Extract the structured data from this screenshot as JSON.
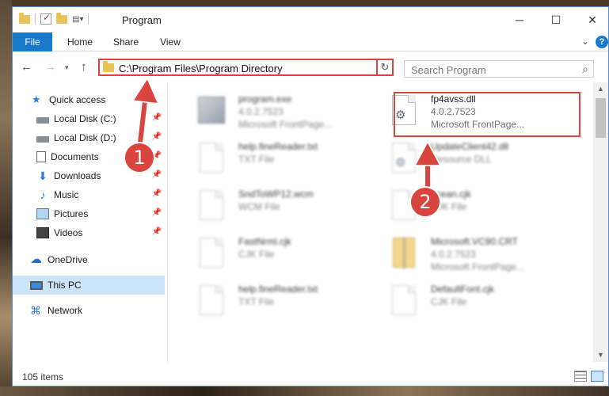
{
  "window": {
    "title": "Program",
    "minimize": "─",
    "maximize": "☐",
    "close": "✕"
  },
  "ribbon": {
    "tabs": [
      "File",
      "Home",
      "Share",
      "View"
    ],
    "expand": "⌄",
    "help": "?"
  },
  "nav": {
    "back": "←",
    "forward": "→",
    "history": "▾",
    "up": "↑",
    "address": "C:\\Program Files\\Program Directory",
    "address_dropdown": "⌄",
    "refresh": "↻",
    "search_placeholder": "Search Program",
    "search_icon": "⌕"
  },
  "sidebar": {
    "items": [
      {
        "label": "Quick access",
        "icon": "star-icon",
        "pinned": false
      },
      {
        "label": "Local Disk (C:)",
        "icon": "disk-icon",
        "pinned": true
      },
      {
        "label": "Local Disk (D:)",
        "icon": "disk-icon",
        "pinned": true
      },
      {
        "label": "Documents",
        "icon": "document-icon",
        "pinned": true
      },
      {
        "label": "Downloads",
        "icon": "download-icon",
        "pinned": true
      },
      {
        "label": "Music",
        "icon": "music-icon",
        "pinned": true
      },
      {
        "label": "Pictures",
        "icon": "pictures-icon",
        "pinned": true
      },
      {
        "label": "Videos",
        "icon": "videos-icon",
        "pinned": true
      },
      {
        "label": "OneDrive",
        "icon": "cloud-icon",
        "pinned": false
      },
      {
        "label": "This PC",
        "icon": "pc-icon",
        "pinned": false,
        "selected": true
      },
      {
        "label": "Network",
        "icon": "network-icon",
        "pinned": false
      }
    ],
    "pin_glyph": "📌"
  },
  "files": [
    {
      "name": "program.exe",
      "line1": "4.0.2.7523",
      "line2": "Microsoft FrontPage...",
      "icon": "exe"
    },
    {
      "name": "fp4avss.dll",
      "line1": "4.0.2.7523",
      "line2": "Microsoft FrontPage...",
      "icon": "dll"
    },
    {
      "name": "help.fineReader.txt",
      "line1": "TXT File",
      "line2": "",
      "icon": "page"
    },
    {
      "name": "UpdateClient42.dll",
      "line1": "Resource DLL",
      "line2": "",
      "icon": "dll"
    },
    {
      "name": "SndToWP12.wcm",
      "line1": "WCM File",
      "line2": "",
      "icon": "page"
    },
    {
      "name": "ocean.cjk",
      "line1": "CJK File",
      "line2": "",
      "icon": "page"
    },
    {
      "name": "FastNrml.cjk",
      "line1": "CJK File",
      "line2": "",
      "icon": "page"
    },
    {
      "name": "Microsoft.VC90.CRT",
      "line1": "4.0.2.7523",
      "line2": "Microsoft FrontPage...",
      "icon": "zip"
    },
    {
      "name": "help.fineReader.txt",
      "line1": "TXT File",
      "line2": "",
      "icon": "page"
    },
    {
      "name": "DefaultFont.cjk",
      "line1": "CJK File",
      "line2": "",
      "icon": "page"
    }
  ],
  "status": {
    "item_count": "105 items"
  },
  "annotations": {
    "marker1": "1",
    "marker2": "2",
    "color": "#d9443e"
  }
}
